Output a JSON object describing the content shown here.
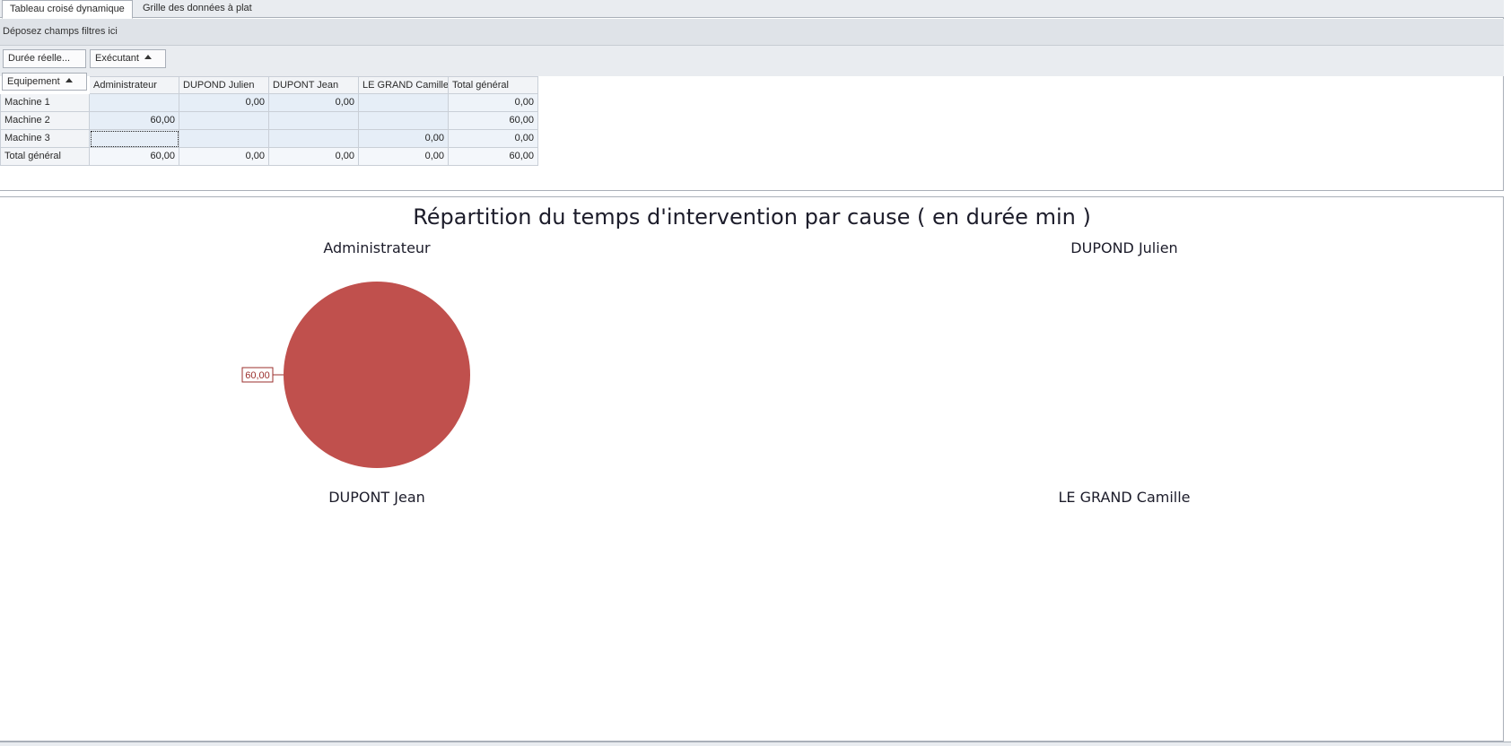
{
  "tabs": [
    {
      "label": "Tableau croisé dynamique",
      "active": true
    },
    {
      "label": "Grille des données à plat",
      "active": false
    }
  ],
  "pivot": {
    "filter_placeholder": "Déposez champs filtres ici",
    "data_field": "Durée réelle...",
    "column_field": "Exécutant",
    "row_field": "Equipement",
    "columns": [
      "Administrateur",
      "DUPOND Julien",
      "DUPONT Jean",
      "LE GRAND Camille",
      "Total général"
    ],
    "rows": [
      {
        "label": "Machine 1",
        "values": [
          "",
          "0,00",
          "0,00",
          "",
          "0,00"
        ]
      },
      {
        "label": "Machine 2",
        "values": [
          "60,00",
          "",
          "",
          "",
          "60,00"
        ]
      },
      {
        "label": "Machine 3",
        "values": [
          "",
          "",
          "",
          "0,00",
          "0,00"
        ]
      },
      {
        "label": "Total général",
        "values": [
          "60,00",
          "0,00",
          "0,00",
          "0,00",
          "60,00"
        ]
      }
    ]
  },
  "chart": {
    "title": "Répartition du temps d'intervention par cause ( en durée min )",
    "pie_color": "#c0504d",
    "label_color": "#9b2f2c"
  },
  "chart_data": {
    "type": "pie",
    "title": "Répartition du temps d'intervention par cause ( en durée min )",
    "panes": [
      {
        "name": "Administrateur",
        "slices": [
          {
            "value": 60,
            "label": "60,00"
          }
        ]
      },
      {
        "name": "DUPOND Julien",
        "slices": []
      },
      {
        "name": "DUPONT Jean",
        "slices": []
      },
      {
        "name": "LE GRAND Camille",
        "slices": []
      }
    ]
  }
}
